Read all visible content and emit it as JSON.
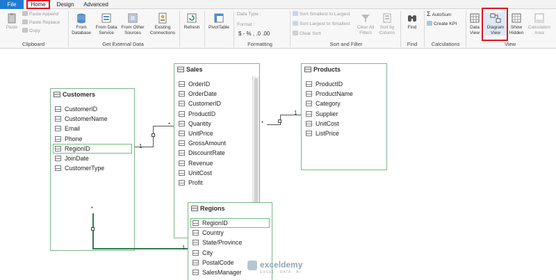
{
  "tabs": {
    "file": "File",
    "home": "Home",
    "design": "Design",
    "advanced": "Advanced"
  },
  "ribbon": {
    "clipboard": {
      "label": "Clipboard",
      "paste": "Paste",
      "paste_append": "Paste Append",
      "paste_replace": "Paste Replace",
      "copy": "Copy"
    },
    "external": {
      "label": "Get External Data",
      "from_database": "From\nDatabase",
      "from_data_service": "From Data\nService",
      "from_other_sources": "From Other\nSources",
      "existing_connections": "Existing\nConnections"
    },
    "refresh": "Refresh",
    "pivottable": "PivotTable",
    "formatting": {
      "label": "Formatting",
      "data_type": "Data Type :",
      "format": "Format :",
      "symbols": "$ - % ,  .0 .00"
    },
    "sort": {
      "label": "Sort and Filter",
      "asc": "Sort Smallest to Largest",
      "desc": "Sort Largest to Smallest",
      "clear_sort": "Clear Sort",
      "clear_filters": "Clear All\nFilters",
      "sort_by_column": "Sort by\nColumn"
    },
    "find": {
      "label": "Find",
      "button": "Find"
    },
    "calculations": {
      "label": "Calculations",
      "autosum": "AutoSum",
      "create_kpi": "Create KPI"
    },
    "view": {
      "label": "View",
      "data_view": "Data\nView",
      "diagram_view": "Diagram\nView",
      "show_hidden": "Show\nHidden",
      "calculation_area": "Calculation\nArea"
    }
  },
  "tables": {
    "customers": {
      "name": "Customers",
      "fields": [
        "CustomerID",
        "CustomerName",
        "Email",
        "Phone",
        "RegionID",
        "JoinDate",
        "CustomerType"
      ]
    },
    "sales": {
      "name": "Sales",
      "fields": [
        "OrderID",
        "OrderDate",
        "CustomerID",
        "ProductID",
        "Quantity",
        "UnitPrice",
        "GrossAmount",
        "DiscountRate",
        "Revenue",
        "UnitCost",
        "Profit"
      ]
    },
    "products": {
      "name": "Products",
      "fields": [
        "ProductID",
        "ProductName",
        "Category",
        "Supplier",
        "UnitCost",
        "ListPrice"
      ]
    },
    "regions": {
      "name": "Regions",
      "fields": [
        "RegionID",
        "Country",
        "State/Province",
        "City",
        "PostalCode",
        "SalesManager"
      ]
    }
  },
  "relationships": {
    "one": "1",
    "many": "*"
  },
  "watermark": {
    "brand": "exceldemy",
    "tagline": "EXCEL · DATA · BI"
  },
  "colors": {
    "file_tab": "#1f7bd1",
    "highlight": "#e0141e",
    "relationship": "#2e7d4f",
    "table_border": "#7bb68a"
  }
}
